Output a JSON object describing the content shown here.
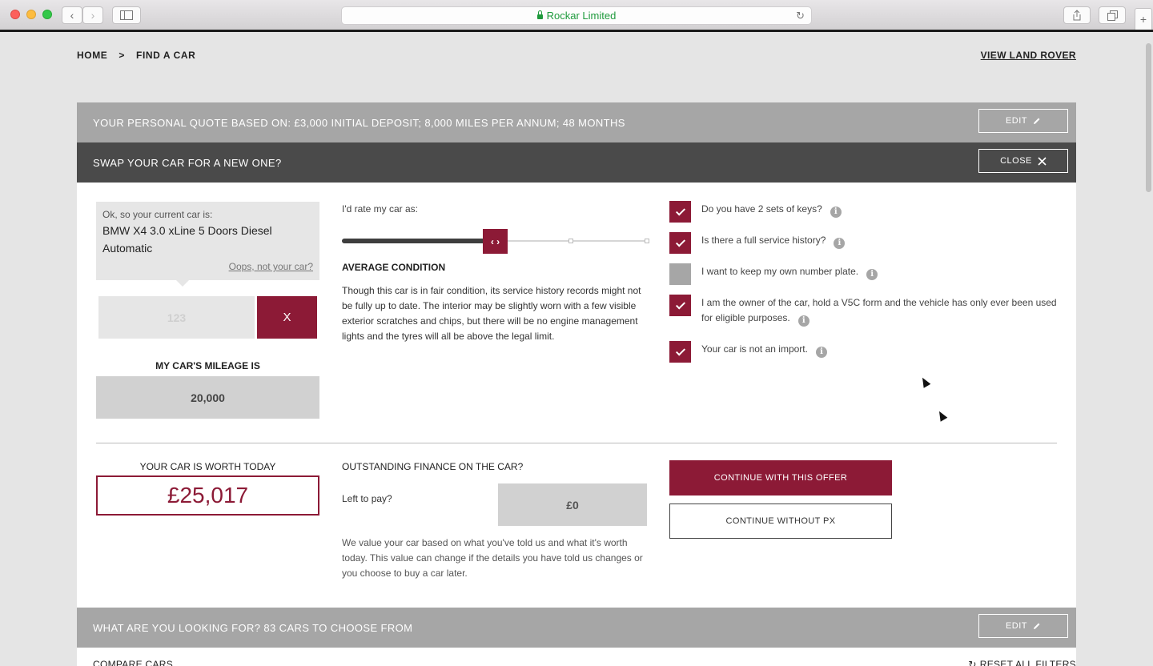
{
  "browser": {
    "address": "Rockar Limited",
    "back_icon": "chevron-left-icon",
    "forward_icon": "chevron-right-icon",
    "sidebar_icon": "sidebar-icon",
    "share_icon": "share-icon",
    "tabs_icon": "tabs-icon",
    "new_tab_icon": "plus-icon"
  },
  "breadcrumb": {
    "home": "HOME",
    "separator": ">",
    "current": "FIND A CAR"
  },
  "view_link": "VIEW LAND ROVER",
  "quote_bar": {
    "text": "YOUR PERSONAL QUOTE BASED ON: £3,000 INITIAL DEPOSIT; 8,000 MILES PER ANNUM; 48 MONTHS",
    "edit_label": "EDIT"
  },
  "swap_bar": {
    "text": "SWAP YOUR CAR FOR A NEW ONE?",
    "close_label": "CLOSE"
  },
  "current_car": {
    "intro": "Ok, so your current car is:",
    "name": "BMW X4 3.0 xLine 5 Doors Diesel Automatic",
    "oops_link": "Oops, not your car?"
  },
  "registration": {
    "placeholder": "123",
    "clear_label": "X"
  },
  "mileage": {
    "label": "MY CAR'S MILEAGE IS",
    "value": "20,000"
  },
  "rating": {
    "label": "I'd rate my car as:",
    "handle_glyph": "‹ ›",
    "level": 0.5,
    "condition_title": "AVERAGE CONDITION",
    "condition_desc": "Though this car is in fair condition, its service history records might not be fully up to date. The interior may be slightly worn with a few visible exterior scratches and chips, but there will be no engine management lights and the tyres will all be above the legal limit."
  },
  "checks": [
    {
      "label": "Do you have 2 sets of keys?",
      "checked": true
    },
    {
      "label": "Is there a full service history?",
      "checked": true
    },
    {
      "label": "I want to keep my own number plate.",
      "checked": false
    },
    {
      "label": "I am the owner of the car, hold a V5C form and the vehicle has only ever been used for eligible purposes.",
      "checked": true
    },
    {
      "label": "Your car is not an import.",
      "checked": true
    }
  ],
  "worth": {
    "label": "YOUR CAR IS WORTH TODAY",
    "value": "£25,017"
  },
  "finance": {
    "title": "OUTSTANDING FINANCE ON THE CAR?",
    "left_label": "Left to pay?",
    "value": "£0",
    "note": "We value your car based on what you've told us and what it's worth today. This value can change if the details you have told us changes or you choose to buy a car later."
  },
  "actions": {
    "continue_offer": "CONTINUE WITH THIS OFFER",
    "continue_without": "CONTINUE WITHOUT PX"
  },
  "search_bar": {
    "text": "WHAT ARE YOU LOOKING FOR? 83 CARS TO CHOOSE FROM",
    "edit_label": "EDIT"
  },
  "footer": {
    "compare": "COMPARE CARS",
    "reset": "RESET ALL FILTERS"
  },
  "colors": {
    "accent": "#8c1a36",
    "bar_light": "#a6a6a6",
    "bar_dark": "#4a4a4a"
  }
}
